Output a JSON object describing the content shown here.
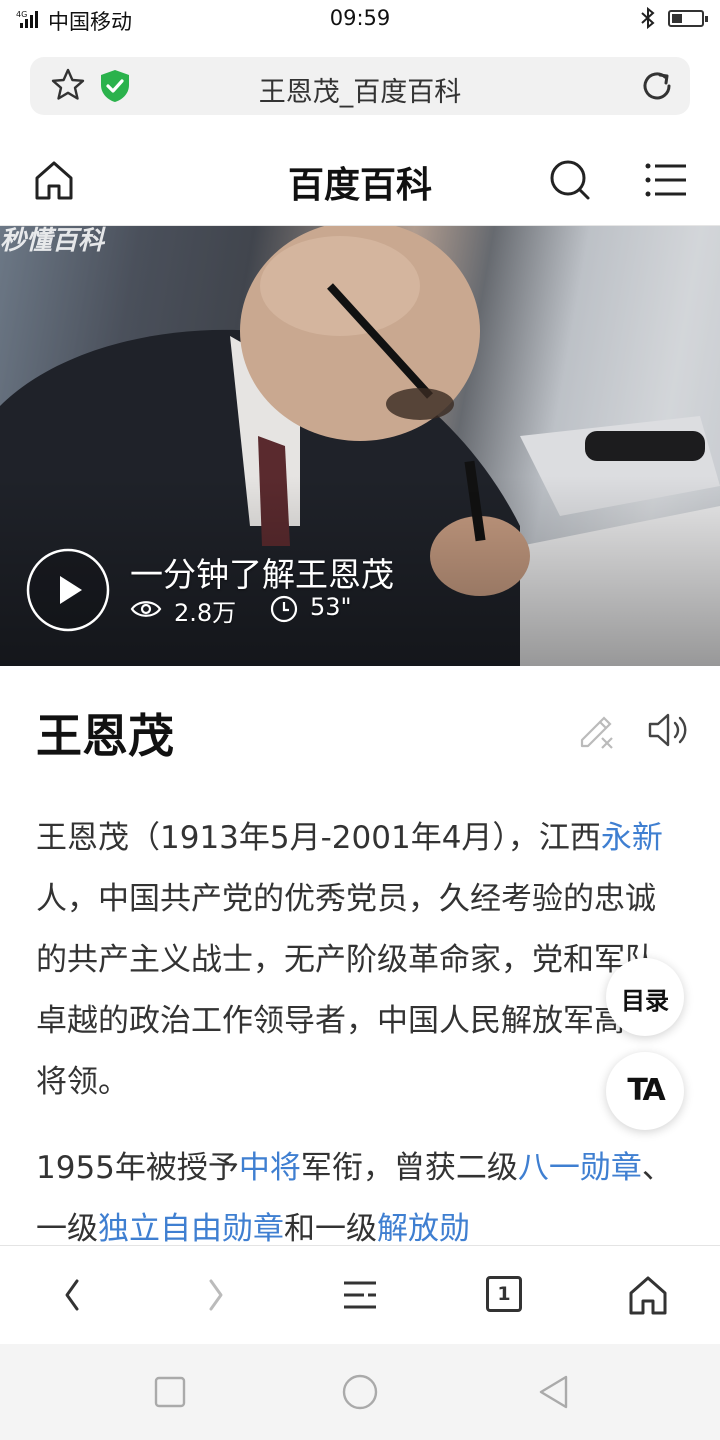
{
  "status_bar": {
    "signal": "4G",
    "carrier": "中国移动",
    "time": "09:59"
  },
  "address_bar": {
    "page_title": "王恩茂_百度百科"
  },
  "site_header": {
    "logo_text": "百度百科"
  },
  "video": {
    "watermark": "秒懂百科",
    "title": "一分钟了解王恩茂",
    "views": "2.8万",
    "duration": "53\""
  },
  "article": {
    "heading": "王恩茂",
    "para1": {
      "t1": "王恩茂（1913年5月-2001年4月），江西",
      "link1": "永新",
      "t2": "人，中国共产党的优秀党员，久经考验的忠诚的共产主义战士，无产阶级革命家，党和军队卓越的政治工作领导者，中国人民解放军高级将领。"
    },
    "para2": {
      "t1": "1955年被授予",
      "link1": "中将",
      "t2": "军衔，曾获二级",
      "link2": "八一勋章",
      "t3": "、一级",
      "link3": "独立自由勋章",
      "t4": "和一级",
      "link4": "解放勋"
    }
  },
  "floating": {
    "toc_label": "目录",
    "ta_label": "TA"
  },
  "toolbar": {
    "tab_count": "1"
  },
  "icons": [
    "signal-icon",
    "bluetooth-icon",
    "battery-icon",
    "star-icon",
    "shield-icon",
    "reload-icon",
    "home-icon",
    "search-icon",
    "menu-icon",
    "play-icon",
    "eye-icon",
    "clock-icon",
    "edit-icon",
    "speaker-icon",
    "back-icon",
    "forward-icon",
    "list-icon",
    "tabs-icon",
    "square-icon",
    "circle-icon",
    "triangle-back-icon"
  ],
  "colors": {
    "link": "#3f7fd1",
    "shield": "#2bb24c",
    "text": "#333333"
  }
}
